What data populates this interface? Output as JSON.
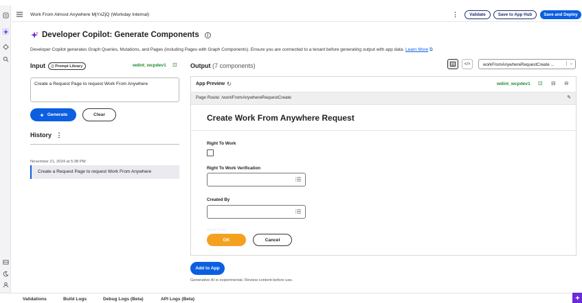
{
  "header": {
    "app_name": "Work From Almost Anywhere MjYxZjQ",
    "app_context": "(Workday Internal)",
    "validate_label": "Validate",
    "save_hub_label": "Save to App Hub",
    "save_deploy_label": "Save and Deploy"
  },
  "page": {
    "title": "Developer Copilot: Generate Components",
    "description": "Developer Copilot generates Graph Queries, Mutations, and Pages (including Pages with Graph Components). Ensure you are connected to a tenant before generating output with app data.",
    "learn_more": "Learn More"
  },
  "input": {
    "heading": "Input",
    "prompt_library": "Prompt Library",
    "tenant": "wdint_wcpdev1",
    "prompt_text": "Create a Request Page to request Work From Anywhere",
    "generate_label": "Generate",
    "clear_label": "Clear"
  },
  "history": {
    "heading": "History",
    "items": [
      {
        "date": "November 21, 2024 at 5:38 PM",
        "text": "Create a Request Page to request Work From Anywhere"
      }
    ]
  },
  "output": {
    "heading": "Output",
    "count": "(7 components)",
    "code_toggle": "</>",
    "selected_component": "workFromAnywhereRequestCreate ..."
  },
  "preview": {
    "label": "App Preview",
    "tenant": "wdint_wcpdev1",
    "route": "Page Route:  /workFromAnywhereRequestCreate",
    "form_title": "Create Work From Anywhere Request",
    "fields": [
      {
        "label": "Right To Work",
        "type": "checkbox"
      },
      {
        "label": "Right To Work Verification",
        "type": "select"
      },
      {
        "label": "Created By",
        "type": "select"
      },
      {
        "label": "Start Date",
        "type": "date"
      }
    ],
    "ok_label": "OK",
    "cancel_label": "Cancel"
  },
  "footer": {
    "add_to_app": "Add to App",
    "note": "Generative AI is experimental. Review content before use."
  },
  "bottom_tabs": [
    "Validations",
    "Build Logs",
    "Debug Logs (Beta)",
    "API Logs (Beta)"
  ],
  "colors": {
    "accent": "#0b5fe0",
    "ok": "#f4a11f",
    "tenant": "#1f8a2e",
    "ai": "#6b2bd9"
  }
}
